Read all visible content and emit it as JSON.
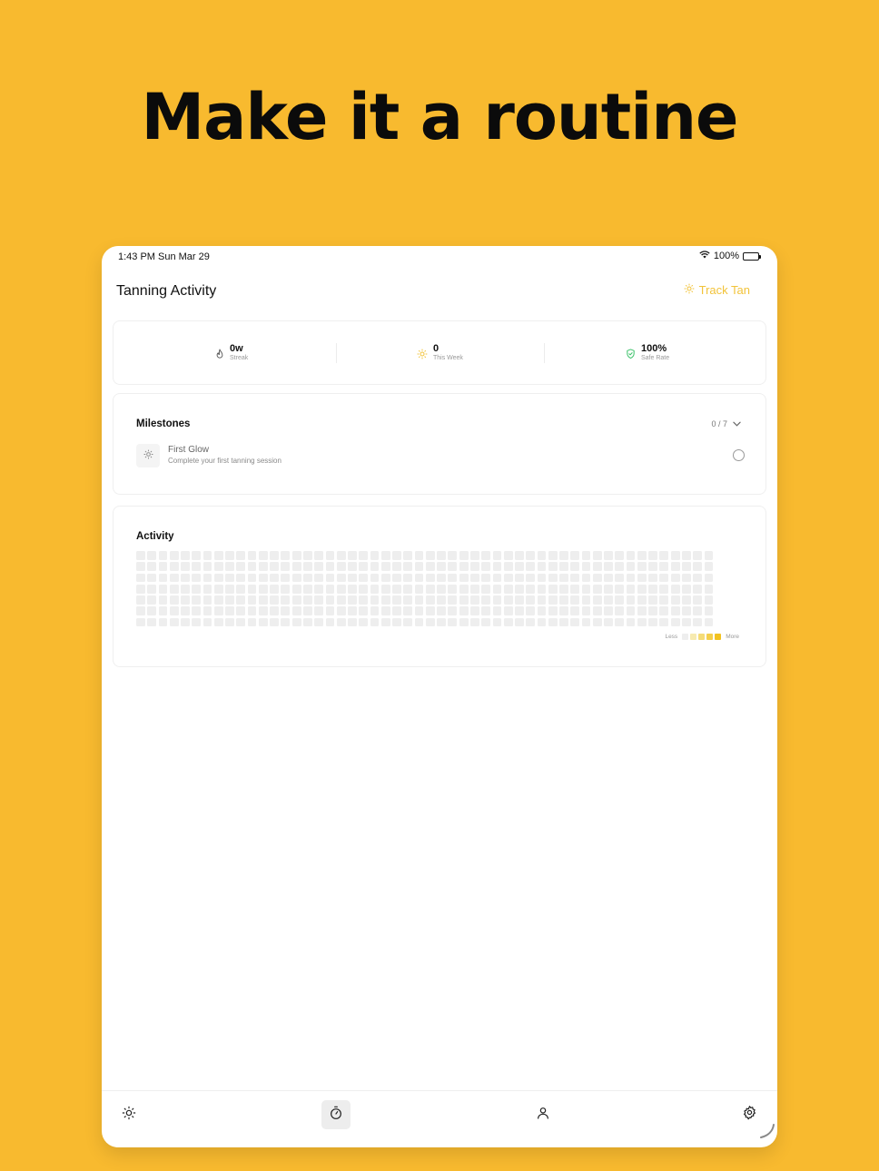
{
  "headline": "Make it a routine",
  "status_bar": {
    "time": "1:43 PM",
    "date": "Sun Mar 29",
    "battery": "100%"
  },
  "nav": {
    "title": "Tanning Activity",
    "action_label": "Track Tan",
    "action_icon": "sun-icon"
  },
  "stats": [
    {
      "icon": "flame-icon",
      "value": "0w",
      "label": "Streak"
    },
    {
      "icon": "sun-icon",
      "value": "0",
      "label": "This Week"
    },
    {
      "icon": "shield-check-icon",
      "value": "100%",
      "label": "Safe Rate"
    }
  ],
  "milestones": {
    "title": "Milestones",
    "count": "0 / 7",
    "items": [
      {
        "icon": "sun-icon",
        "name": "First Glow",
        "description": "Complete your first tanning session",
        "completed": false
      }
    ]
  },
  "activity": {
    "title": "Activity",
    "weeks": 52,
    "days": 7,
    "legend_less": "Less",
    "legend_more": "More",
    "legend_colors": [
      "#EEEEEE",
      "#F7EAB0",
      "#F5DC78",
      "#F4CF4C",
      "#F2C21F"
    ]
  },
  "tabs": [
    {
      "icon": "sun-icon",
      "active": false
    },
    {
      "icon": "timer-icon",
      "active": true
    },
    {
      "icon": "person-icon",
      "active": false
    },
    {
      "icon": "gear-icon",
      "active": false
    }
  ],
  "colors": {
    "background": "#F8BA2F",
    "accent": "#F2C33A",
    "safe_green": "#3CC26A"
  }
}
